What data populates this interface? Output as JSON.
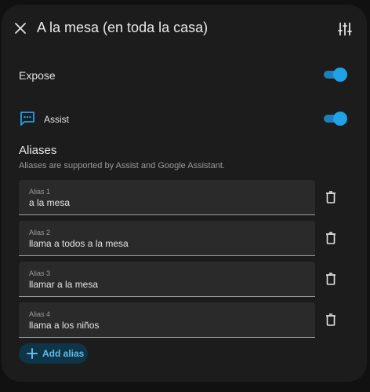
{
  "dialog": {
    "title": "A la mesa (en toda la casa)",
    "close_icon": "close-icon",
    "settings_icon": "tune-sliders-icon"
  },
  "expose": {
    "label": "Expose",
    "enabled": true
  },
  "assist": {
    "label": "Assist",
    "icon": "message-processing-icon",
    "enabled": true
  },
  "aliases": {
    "title": "Aliases",
    "subtitle": "Aliases are supported by Assist and Google Assistant.",
    "items": [
      {
        "label": "Alias 1",
        "value": "a la mesa"
      },
      {
        "label": "Alias 2",
        "value": "llama a todos a la mesa"
      },
      {
        "label": "Alias 3",
        "value": "llamar a la mesa"
      },
      {
        "label": "Alias 4",
        "value": "llama a los niños"
      }
    ],
    "add_label": "Add alias"
  },
  "colors": {
    "accent": "#1fa2e6",
    "surface": "#1c1c1c",
    "field": "#2a2a2a",
    "add_button_bg": "#0d3447",
    "add_button_text": "#63b9ea"
  }
}
